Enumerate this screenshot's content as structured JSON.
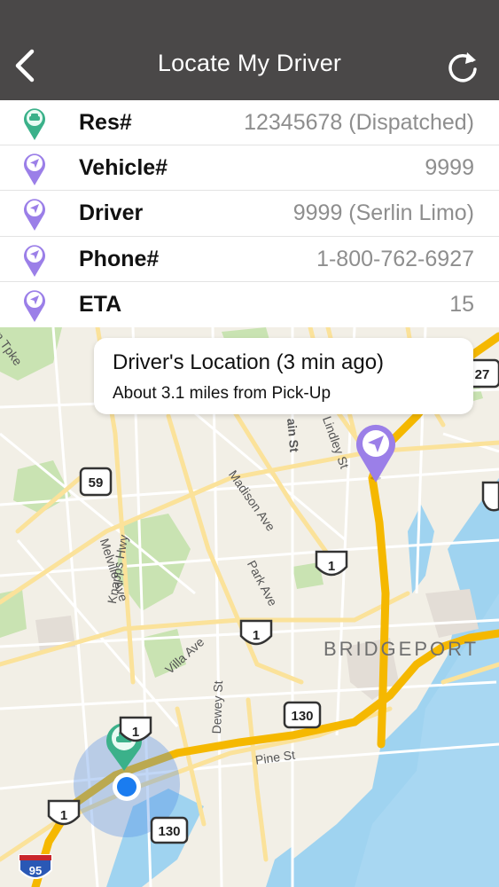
{
  "navbar": {
    "title": "Locate My Driver",
    "back_icon": "chevron-left-icon",
    "refresh_icon": "refresh-icon"
  },
  "info_rows": [
    {
      "label": "Res#",
      "value": "12345678 (Dispatched)",
      "icon": "car-pin-icon"
    },
    {
      "label": "Vehicle#",
      "value": "9999",
      "icon": "location-arrow-pin-icon"
    },
    {
      "label": "Driver",
      "value": "9999 (Serlin Limo)",
      "icon": "location-arrow-pin-icon"
    },
    {
      "label": "Phone#",
      "value": "1-800-762-6927",
      "icon": "location-arrow-pin-icon"
    },
    {
      "label": "ETA",
      "value": "15",
      "icon": "location-arrow-pin-icon"
    }
  ],
  "callout": {
    "title": "Driver's Location (3 min ago)",
    "subtitle": "About 3.1 miles from Pick-Up"
  },
  "map": {
    "city_label": "BRIDGEPORT",
    "street_labels": [
      "Madison Ave",
      "Park Ave",
      "Melville Ave",
      "Knapps Hwy",
      "Villa Ave",
      "Dewey St",
      "Pine St",
      "ain St",
      "Lindley St",
      "n Tpke"
    ],
    "route_shields": [
      "59",
      "1",
      "1",
      "1",
      "1",
      "130",
      "130",
      "27",
      "95"
    ]
  },
  "colors": {
    "navbar_bg": "#4a4848",
    "pin_green": "#3bb18a",
    "pin_purple": "#9b7fe8",
    "highway": "#f7c948",
    "water": "#9fd3f0",
    "park": "#c9e3b2"
  }
}
